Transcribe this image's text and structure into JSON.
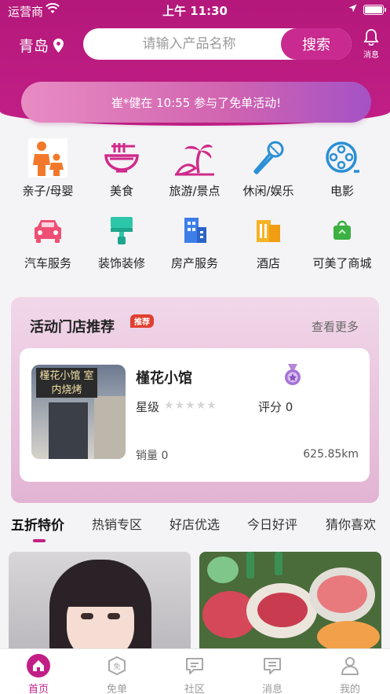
{
  "status_bar": {
    "carrier": "运营商",
    "time": "上午 11:30"
  },
  "header": {
    "city": "青岛",
    "search_placeholder": "请输入产品名称",
    "search_button": "搜索",
    "message_label": "消息"
  },
  "notice": {
    "text": "崔*健在 10:55 参与了免单活动!"
  },
  "categories": [
    {
      "label": "亲子/母婴",
      "icon": "family-icon"
    },
    {
      "label": "美食",
      "icon": "noodle-bowl-icon"
    },
    {
      "label": "旅游/景点",
      "icon": "palm-tree-icon"
    },
    {
      "label": "休闲/娱乐",
      "icon": "microphone-icon"
    },
    {
      "label": "电影",
      "icon": "film-reel-icon"
    },
    {
      "label": "汽车服务",
      "icon": "car-icon"
    },
    {
      "label": "装饰装修",
      "icon": "paint-roller-icon"
    },
    {
      "label": "房产服务",
      "icon": "building-icon"
    },
    {
      "label": "酒店",
      "icon": "hotel-icon"
    },
    {
      "label": "可美了商城",
      "icon": "shopping-bag-icon"
    }
  ],
  "store_section": {
    "title": "活动门店推荐",
    "badge": "推荐",
    "more": "查看更多",
    "store": {
      "name": "槿花小馆",
      "photo_sign": "槿花小馆 室内烧烤",
      "star_label": "星级",
      "rating_stars": 0,
      "score": "评分 0",
      "sales": "销量 0",
      "distance": "625.85km"
    }
  },
  "tabs": [
    "五折特价",
    "热销专区",
    "好店优选",
    "今日好评",
    "猜你喜欢"
  ],
  "active_tab": 0,
  "tabbar": [
    {
      "label": "首页",
      "icon": "home-icon"
    },
    {
      "label": "免单",
      "icon": "free-order-icon"
    },
    {
      "label": "社区",
      "icon": "community-icon"
    },
    {
      "label": "消息",
      "icon": "message-icon"
    },
    {
      "label": "我的",
      "icon": "profile-icon"
    }
  ],
  "colors": {
    "brand": "#c21f86",
    "accent_blue": "#2a8fd6",
    "star_empty": "#d5d5d5"
  }
}
